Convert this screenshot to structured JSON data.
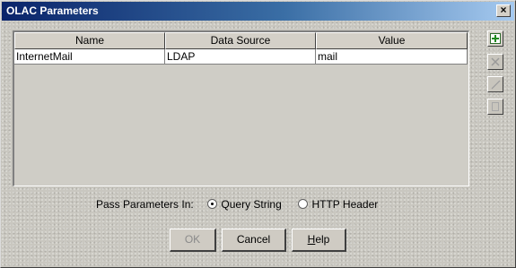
{
  "window": {
    "title": "OLAC Parameters",
    "close_label": "×"
  },
  "table": {
    "columns": [
      "Name",
      "Data Source",
      "Value"
    ],
    "rows": [
      {
        "name": "InternetMail",
        "data_source": "LDAP",
        "value": "mail"
      }
    ]
  },
  "side_buttons": [
    {
      "icon": "add-row-icon",
      "enabled": true
    },
    {
      "icon": "delete-row-icon",
      "enabled": false
    },
    {
      "icon": "edit-icon",
      "enabled": false
    },
    {
      "icon": "properties-icon",
      "enabled": false
    }
  ],
  "pass_parameters": {
    "label": "Pass Parameters In:",
    "options": [
      "Query String",
      "HTTP Header"
    ],
    "selected": "Query String"
  },
  "buttons": {
    "ok": "OK",
    "cancel": "Cancel",
    "help_prefix": "H",
    "help_rest": "elp"
  }
}
